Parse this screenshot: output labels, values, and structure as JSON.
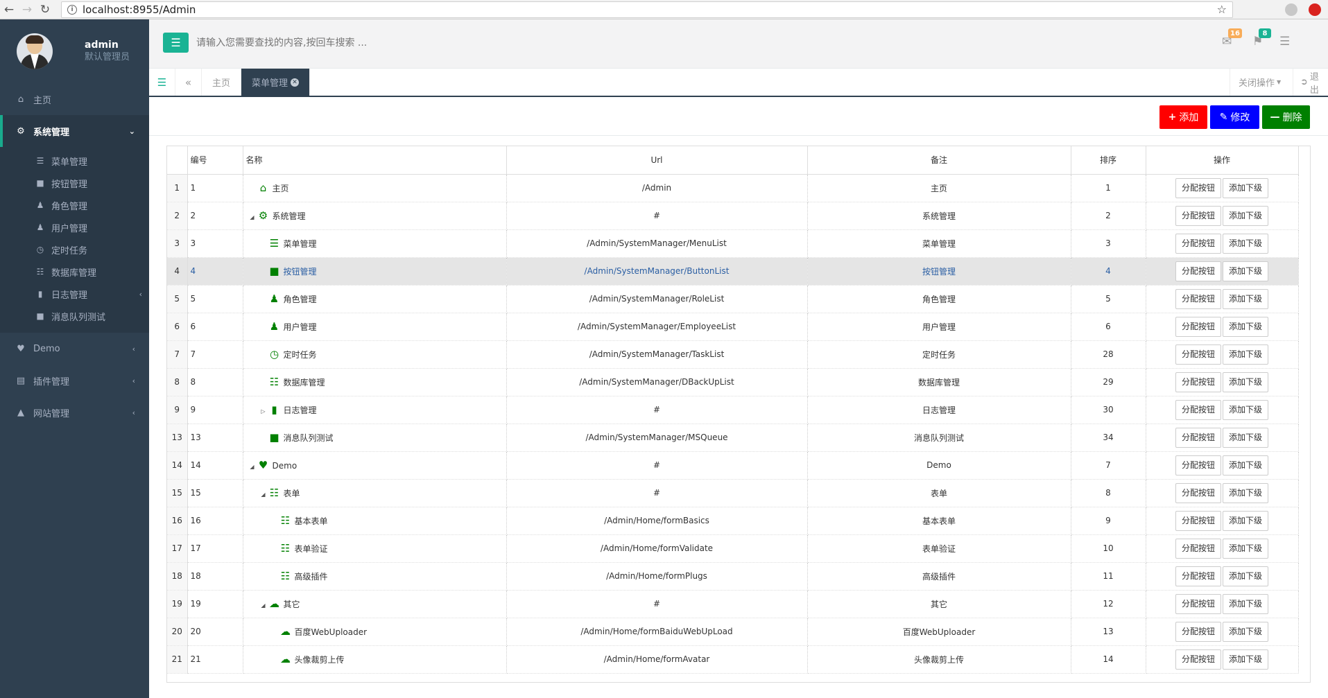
{
  "browser": {
    "url": "localhost:8955/Admin"
  },
  "sidebar": {
    "user": {
      "name": "admin",
      "role": "默认管理员"
    },
    "items": [
      {
        "label": "主页",
        "icon": "home-icon"
      },
      {
        "label": "系统管理",
        "icon": "gear-icon"
      },
      {
        "label": "Demo",
        "icon": "heart-icon"
      },
      {
        "label": "插件管理",
        "icon": "plugin-icon"
      },
      {
        "label": "网站管理",
        "icon": "sitemap-icon"
      }
    ],
    "submenu": [
      {
        "label": "菜单管理",
        "icon": "list-icon"
      },
      {
        "label": "按钮管理",
        "icon": "square-icon"
      },
      {
        "label": "角色管理",
        "icon": "user-icon"
      },
      {
        "label": "用户管理",
        "icon": "user-icon"
      },
      {
        "label": "定时任务",
        "icon": "clock-icon"
      },
      {
        "label": "数据库管理",
        "icon": "database-icon"
      },
      {
        "label": "日志管理",
        "icon": "book-icon"
      },
      {
        "label": "消息队列测试",
        "icon": "square-icon"
      }
    ]
  },
  "header": {
    "search_placeholder": "请输入您需要查找的内容,按回车搜索 ...",
    "mail_count": "16",
    "bell_count": "8",
    "colors": {
      "mail_badge": "#f8ac59",
      "bell_badge": "#1ab394"
    }
  },
  "tabs": {
    "home": "主页",
    "active": "菜单管理",
    "close_ops": "关闭操作",
    "logout": "退出"
  },
  "toolbar": {
    "add": "添加",
    "edit": "修改",
    "delete": "删除",
    "colors": {
      "add": "#ff0000",
      "edit": "#0000ff",
      "delete": "#008000"
    }
  },
  "grid": {
    "columns": [
      "编号",
      "名称",
      "Url",
      "备注",
      "排序",
      "操作"
    ],
    "action_assign": "分配按钮",
    "action_add_child": "添加下级",
    "rows": [
      {
        "rn": "1",
        "id": "1",
        "name": "主页",
        "icon": "home-icon",
        "level": 0,
        "toggle": "",
        "url": "/Admin",
        "remark": "主页",
        "sort": "1"
      },
      {
        "rn": "2",
        "id": "2",
        "name": "系统管理",
        "icon": "gear-icon",
        "level": 0,
        "toggle": "expanded",
        "url": "#",
        "remark": "系统管理",
        "sort": "2"
      },
      {
        "rn": "3",
        "id": "3",
        "name": "菜单管理",
        "icon": "list-icon",
        "level": 1,
        "toggle": "",
        "url": "/Admin/SystemManager/MenuList",
        "remark": "菜单管理",
        "sort": "3"
      },
      {
        "rn": "4",
        "id": "4",
        "name": "按钮管理",
        "icon": "square-icon",
        "level": 1,
        "toggle": "",
        "url": "/Admin/SystemManager/ButtonList",
        "remark": "按钮管理",
        "sort": "4",
        "selected": true
      },
      {
        "rn": "5",
        "id": "5",
        "name": "角色管理",
        "icon": "user-icon",
        "level": 1,
        "toggle": "",
        "url": "/Admin/SystemManager/RoleList",
        "remark": "角色管理",
        "sort": "5"
      },
      {
        "rn": "6",
        "id": "6",
        "name": "用户管理",
        "icon": "user-icon",
        "level": 1,
        "toggle": "",
        "url": "/Admin/SystemManager/EmployeeList",
        "remark": "用户管理",
        "sort": "6"
      },
      {
        "rn": "7",
        "id": "7",
        "name": "定时任务",
        "icon": "clock-icon",
        "level": 1,
        "toggle": "",
        "url": "/Admin/SystemManager/TaskList",
        "remark": "定时任务",
        "sort": "28"
      },
      {
        "rn": "8",
        "id": "8",
        "name": "数据库管理",
        "icon": "database-icon",
        "level": 1,
        "toggle": "",
        "url": "/Admin/SystemManager/DBackUpList",
        "remark": "数据库管理",
        "sort": "29"
      },
      {
        "rn": "9",
        "id": "9",
        "name": "日志管理",
        "icon": "book-icon",
        "level": 1,
        "toggle": "collapsed",
        "url": "#",
        "remark": "日志管理",
        "sort": "30"
      },
      {
        "rn": "13",
        "id": "13",
        "name": "消息队列测试",
        "icon": "square-icon",
        "level": 1,
        "toggle": "",
        "url": "/Admin/SystemManager/MSQueue",
        "remark": "消息队列测试",
        "sort": "34"
      },
      {
        "rn": "14",
        "id": "14",
        "name": "Demo",
        "icon": "heart-icon",
        "level": 0,
        "toggle": "expanded",
        "url": "#",
        "remark": "Demo",
        "sort": "7"
      },
      {
        "rn": "15",
        "id": "15",
        "name": "表单",
        "icon": "form-icon",
        "level": 1,
        "toggle": "expanded",
        "url": "#",
        "remark": "表单",
        "sort": "8"
      },
      {
        "rn": "16",
        "id": "16",
        "name": "基本表单",
        "icon": "form-icon",
        "level": 2,
        "toggle": "",
        "url": "/Admin/Home/formBasics",
        "remark": "基本表单",
        "sort": "9"
      },
      {
        "rn": "17",
        "id": "17",
        "name": "表单验证",
        "icon": "form-icon",
        "level": 2,
        "toggle": "",
        "url": "/Admin/Home/formValidate",
        "remark": "表单验证",
        "sort": "10"
      },
      {
        "rn": "18",
        "id": "18",
        "name": "高级插件",
        "icon": "form-icon",
        "level": 2,
        "toggle": "",
        "url": "/Admin/Home/formPlugs",
        "remark": "高级插件",
        "sort": "11"
      },
      {
        "rn": "19",
        "id": "19",
        "name": "其它",
        "icon": "cloud-icon",
        "level": 1,
        "toggle": "expanded",
        "url": "#",
        "remark": "其它",
        "sort": "12"
      },
      {
        "rn": "20",
        "id": "20",
        "name": "百度WebUploader",
        "icon": "cloud-icon",
        "level": 2,
        "toggle": "",
        "url": "/Admin/Home/formBaiduWebUpLoad",
        "remark": "百度WebUploader",
        "sort": "13"
      },
      {
        "rn": "21",
        "id": "21",
        "name": "头像裁剪上传",
        "icon": "cloud-icon",
        "level": 2,
        "toggle": "",
        "url": "/Admin/Home/formAvatar",
        "remark": "头像裁剪上传",
        "sort": "14"
      }
    ]
  }
}
